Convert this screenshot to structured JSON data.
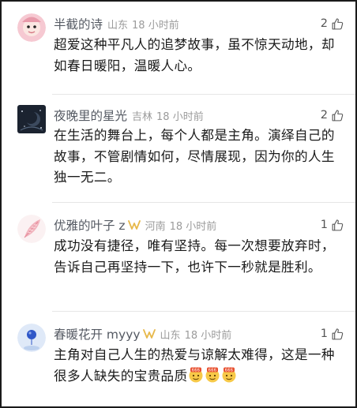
{
  "comments": [
    {
      "user": "半截的诗",
      "location": "山东",
      "time": "18 小时前",
      "likes": "2",
      "avatar_icon": "pink-cartoon-face-avatar",
      "text": "超爱这种平凡人的追梦故事，虽不惊天动地，却如春日暖阳，温暖人心。"
    },
    {
      "user": "夜晚里的星光",
      "location": "吉林",
      "time": "18 小时前",
      "likes": "2",
      "avatar_icon": "dark-starry-night-avatar",
      "text": "在生活的舞台上，每个人都是主角。演绎自己的故事，不管剧情如何，尽情展现，因为你的人生独一无二。"
    },
    {
      "user": "优雅的叶子 z",
      "location": "河南",
      "time": "18 小时前",
      "likes": "1",
      "avatar_icon": "pink-feather-avatar",
      "badge_icon": "gold-vip-badge-icon",
      "text": "成功没有捷径，唯有坚持。每一次想要放弃时，告诉自己再坚持一下，也许下一秒就是胜利。"
    },
    {
      "user": "春暖花开 myyy",
      "location": "山东",
      "time": "18 小时前",
      "likes": "1",
      "avatar_icon": "blue-sky-balloon-avatar",
      "badge_icon": "gold-vip-badge-icon",
      "text": "主角对自己人生的热爱与谅解太难得，这是一种很多人缺失的宝贵品质",
      "emojis": [
        "666-emoji",
        "666-emoji",
        "666-emoji"
      ]
    }
  ],
  "colors": {
    "name": "#555a63",
    "meta": "#9b9b9b",
    "text": "#1a1a1a",
    "badge": "#e7b84a",
    "divider": "#e6e6e6"
  }
}
